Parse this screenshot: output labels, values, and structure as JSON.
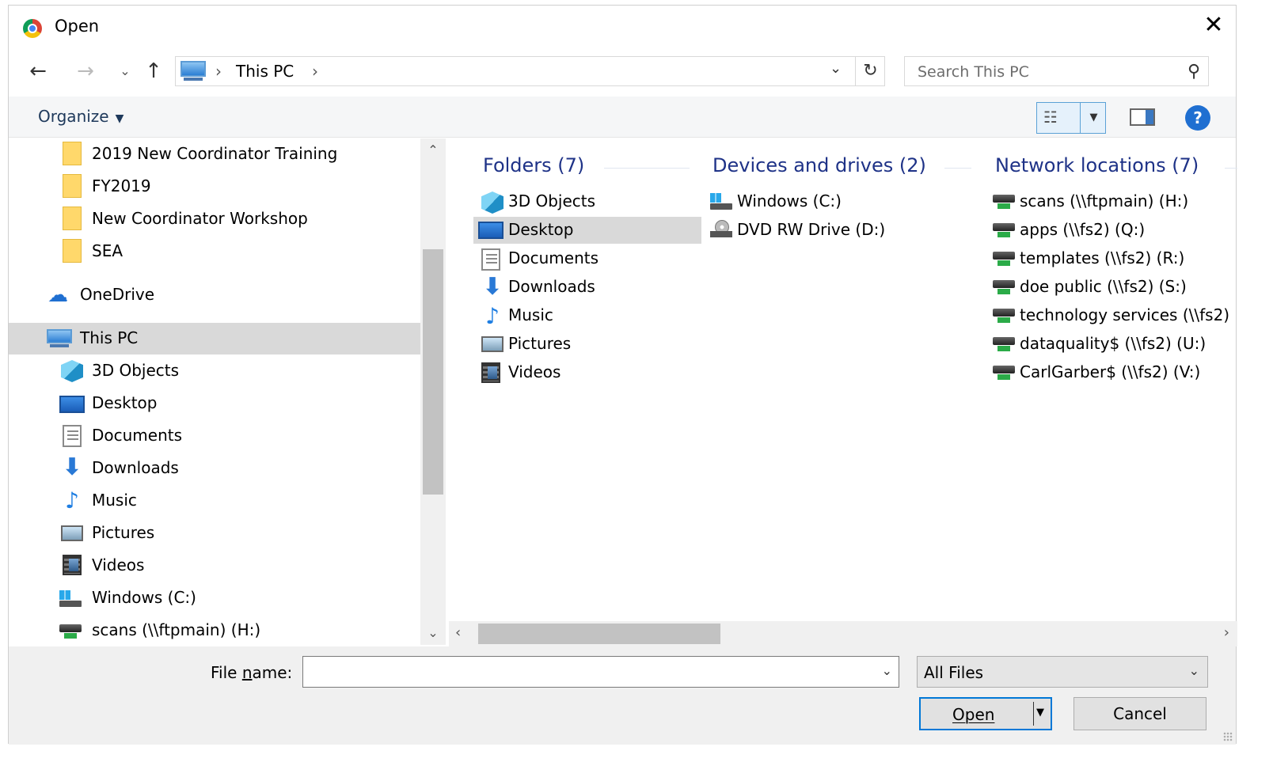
{
  "window": {
    "title": "Open",
    "app_icon": "chrome-icon",
    "close_glyph": "✕"
  },
  "nav": {
    "back": "←",
    "forward": "→",
    "recent": "⌄",
    "up": "↑",
    "address_sep": "›",
    "address_path": "This PC",
    "address_dropdown": "⌄",
    "refresh": "↻"
  },
  "search": {
    "placeholder": "Search This PC",
    "icon": "⚲"
  },
  "toolbar": {
    "organize_label": "Organize",
    "organize_caret": "▼",
    "view_glyph": "☷",
    "view_dropdown": "▼",
    "help_glyph": "?"
  },
  "navpane": {
    "items": [
      {
        "label": "2019  New Coordinator Training",
        "icon": "folder-icon"
      },
      {
        "label": "FY2019",
        "icon": "folder-icon"
      },
      {
        "label": "New Coordinator Workshop",
        "icon": "folder-icon"
      },
      {
        "label": "SEA",
        "icon": "folder-icon"
      },
      {
        "label": "OneDrive",
        "icon": "onedrive-icon"
      },
      {
        "label": "This PC",
        "icon": "this-pc-icon",
        "selected": true
      },
      {
        "label": "3D Objects",
        "icon": "3d-objects-icon"
      },
      {
        "label": "Desktop",
        "icon": "desktop-icon"
      },
      {
        "label": "Documents",
        "icon": "documents-icon"
      },
      {
        "label": "Downloads",
        "icon": "downloads-icon"
      },
      {
        "label": "Music",
        "icon": "music-icon"
      },
      {
        "label": "Pictures",
        "icon": "pictures-icon"
      },
      {
        "label": "Videos",
        "icon": "videos-icon"
      },
      {
        "label": "Windows (C:)",
        "icon": "windows-drive-icon"
      },
      {
        "label": "scans (\\\\ftpmain) (H:)",
        "icon": "network-drive-icon"
      }
    ],
    "scroll_up": "⌃",
    "scroll_down": "⌄"
  },
  "content": {
    "groups": [
      {
        "header": "Folders (7)",
        "items": [
          {
            "label": "3D Objects",
            "icon": "3d-objects-icon"
          },
          {
            "label": "Desktop",
            "icon": "desktop-icon",
            "selected": true
          },
          {
            "label": "Documents",
            "icon": "documents-icon"
          },
          {
            "label": "Downloads",
            "icon": "downloads-icon"
          },
          {
            "label": "Music",
            "icon": "music-icon"
          },
          {
            "label": "Pictures",
            "icon": "pictures-icon"
          },
          {
            "label": "Videos",
            "icon": "videos-icon"
          }
        ]
      },
      {
        "header": "Devices and drives (2)",
        "items": [
          {
            "label": "Windows (C:)",
            "icon": "windows-drive-icon"
          },
          {
            "label": "DVD RW Drive (D:)",
            "icon": "dvd-drive-icon"
          }
        ]
      },
      {
        "header": "Network locations (7)",
        "items": [
          {
            "label": "scans (\\\\ftpmain) (H:)",
            "icon": "network-drive-icon"
          },
          {
            "label": "apps (\\\\fs2) (Q:)",
            "icon": "network-drive-icon"
          },
          {
            "label": "templates (\\\\fs2) (R:)",
            "icon": "network-drive-icon"
          },
          {
            "label": "doe public (\\\\fs2) (S:)",
            "icon": "network-drive-icon"
          },
          {
            "label": "technology services (\\\\fs2)",
            "icon": "network-drive-icon"
          },
          {
            "label": "dataquality$ (\\\\fs2) (U:)",
            "icon": "network-drive-icon"
          },
          {
            "label": "CarlGarber$ (\\\\fs2) (V:)",
            "icon": "network-drive-icon"
          }
        ]
      }
    ],
    "scroll_left": "‹",
    "scroll_right": "›"
  },
  "bottom": {
    "file_name_label_pre": "File ",
    "file_name_label_key": "n",
    "file_name_label_post": "ame:",
    "file_name_value": "",
    "file_name_dropdown": "⌄",
    "file_type": "All Files",
    "file_type_dropdown": "⌄",
    "open_label": "Open",
    "open_dropdown": "▼",
    "cancel_label": "Cancel"
  }
}
